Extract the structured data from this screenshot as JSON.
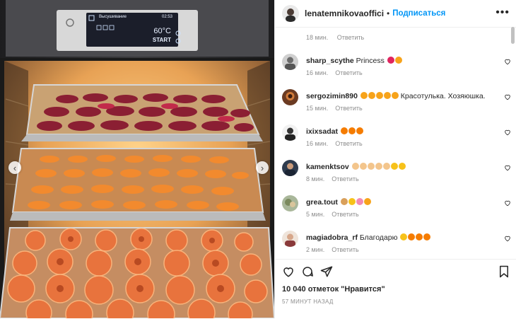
{
  "post": {
    "username": "lenatemnikovaofficial",
    "follow_label": "Подписаться",
    "likes_text": "10 040 отметок \"Нравится\"",
    "time_ago": "57 МИНУТ НАЗАД"
  },
  "oven_display": {
    "mode": "Высушивание",
    "time": "02:53",
    "temperature": "60°C",
    "start": "START"
  },
  "comments": {
    "top_meta": {
      "time": "18 мин.",
      "reply": "Ответить"
    },
    "items": [
      {
        "username": "sharp_scythe",
        "text": "Princess",
        "emojis": [
          "#e0245e",
          "#f7a31a"
        ],
        "time": "16 мин.",
        "reply": "Ответить",
        "likes": ""
      },
      {
        "username": "sergozimin890",
        "text": "",
        "emojis": [
          "#f7a31a",
          "#f7a31a",
          "#f7a31a",
          "#f7a31a",
          "#f7a31a"
        ],
        "text_after": "Красотулька. Хозяюшка.",
        "time": "15 мин.",
        "reply": "Ответить",
        "likes": ""
      },
      {
        "username": "ixixsadat",
        "text": "",
        "emojis": [
          "#f57c00",
          "#f57c00",
          "#f57c00"
        ],
        "time": "16 мин.",
        "reply": "Ответить",
        "likes": ""
      },
      {
        "username": "kamenktsov",
        "text": "",
        "emojis": [
          "#f3c58c",
          "#f3c58c",
          "#f3c58c",
          "#f3c58c",
          "#f3c58c",
          "#f7c21a",
          "#f7c21a"
        ],
        "time": "8 мин.",
        "reply": "Ответить",
        "likes": ""
      },
      {
        "username": "grea.tout",
        "text": "",
        "emojis": [
          "#d9a05b",
          "#f7c21a",
          "#f28bb3",
          "#f7a31a"
        ],
        "time": "5 мин.",
        "reply": "Ответить",
        "likes": ""
      },
      {
        "username": "magiadobra_rf",
        "text": "Благодарю",
        "emojis": [
          "#f7c21a",
          "#f57c00",
          "#f57c00",
          "#f57c00"
        ],
        "time": "2 мин.",
        "reply": "Ответить",
        "likes": ""
      }
    ]
  },
  "icons": {
    "like": "heart-outline-icon",
    "comment": "speech-bubble-icon",
    "share": "paper-plane-icon",
    "save": "bookmark-icon",
    "more": "ellipsis-icon",
    "prev": "chevron-left-icon",
    "next": "chevron-right-icon"
  },
  "colors": {
    "accent": "#0095f6",
    "muted": "#8e8e8e",
    "border": "#efefef"
  }
}
